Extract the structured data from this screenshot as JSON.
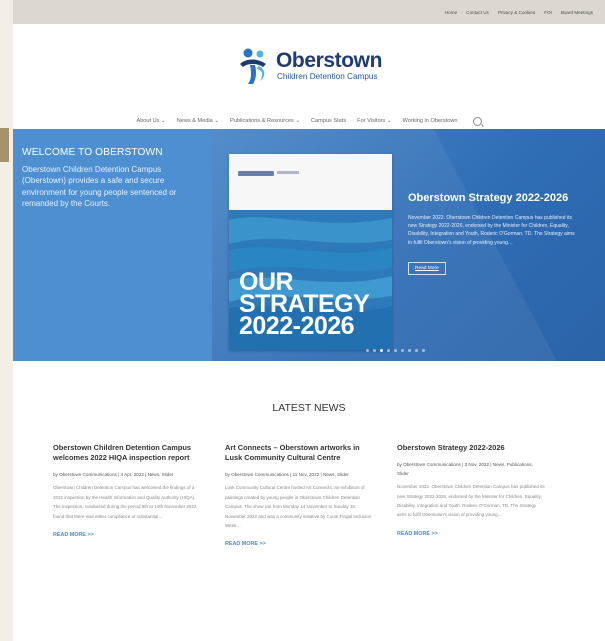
{
  "topbar": {
    "links": [
      "Home",
      "Contact Us",
      "Privacy & Cookies",
      "FOI",
      "Board Meetings"
    ]
  },
  "logo": {
    "title": "Oberstown",
    "subtitle": "Children Detention Campus",
    "brand_color": "#1f3c72"
  },
  "nav": {
    "items": [
      "About Us ⌄",
      "News & Media ⌄",
      "Publications & Resources ⌄",
      "Campus Stats",
      "For Visitors ⌄",
      "Working in Oberstown"
    ],
    "search_icon": "search-icon"
  },
  "hero": {
    "welcome_title": "WELCOME TO OBERSTOWN",
    "welcome_text": "Oberstown Children Detention Campus (Oberstown) provides a safe and secure environment for young people sentenced or remanded by the Courts.",
    "cover_title": "OUR STRATEGY 2022-2026",
    "slide_title": "Oberstown Strategy 2022-2026",
    "slide_body": "November 2022. Oberstown Children Detention Campus has published its new Strategy 2022-2026, endorsed by the Minister for Children, Equality, Disability, Integration and Youth, Roderic O'Gorman, TD. The Strategy aims to fulfil Oberstown's vision of providing young…",
    "read_more": "Read More",
    "accent_color": "#4d8fd0"
  },
  "news": {
    "heading": "LATEST NEWS",
    "items": [
      {
        "title": "Oberstown Children Detention Campus welcomes 2022 HIQA inspection report",
        "meta": "by Oberstown Communications | 4 Apr, 2023 | News, Slider",
        "excerpt": "Oberstown Children Detention Campus has welcomed the findings of a 2022 inspection by the Health Information and Quality Authority (HIQA). The inspection, conducted during the period 8th to 14th November 2022, found that there was either compliance or substantial…",
        "read_more": "READ MORE >>"
      },
      {
        "title": "Art Connects – Oberstown artworks in Lusk Community Cultural Centre",
        "meta": "by Oberstown Communications | 11 Nov, 2022 | News, Slider",
        "excerpt": "Lusk Community Cultural Centre hosted Art Connects, an exhibition of paintings created by young people in Oberstown Children Detention Campus. The show ran from Monday 14 November to Sunday 20 November 2022 and was a community initiative by Count Fingal Inclusion Week…",
        "read_more": "READ MORE >>"
      },
      {
        "title": "Oberstown Strategy 2022-2026",
        "meta": "by Oberstown Communications | 3 Nov, 2022 | News, Publications, Slider",
        "excerpt": "November 2022. Oberstown Children Detention Campus has published its new Strategy 2022-2026, endorsed by the Minister for Children, Equality, Disability, Integration and Youth, Roderic O'Gorman, TD. The Strategy aims to fulfil Oberstown's vision of providing young…",
        "read_more": "READ MORE >>"
      }
    ]
  }
}
